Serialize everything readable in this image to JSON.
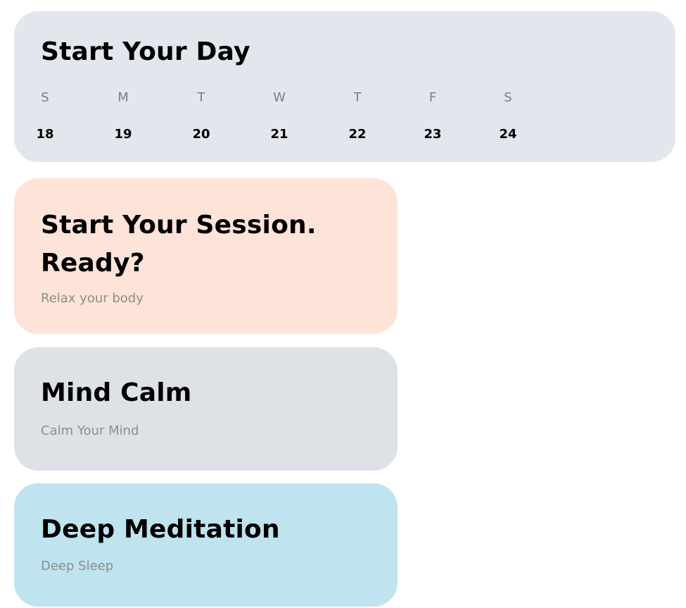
{
  "colors": {
    "day_card_bg": "#e2e6ed",
    "session_card_bg": "#fde3d8",
    "mind_card_bg": "#dee1e6",
    "deep_card_bg": "#bfe3ef"
  },
  "day_card": {
    "title": "Start Your Day",
    "days": [
      {
        "letter": "S",
        "num": "18"
      },
      {
        "letter": "M",
        "num": "19"
      },
      {
        "letter": "T",
        "num": "20"
      },
      {
        "letter": "W",
        "num": "21"
      },
      {
        "letter": "T",
        "num": "22"
      },
      {
        "letter": "F",
        "num": "23"
      },
      {
        "letter": "S",
        "num": "24"
      }
    ]
  },
  "session_card": {
    "title": "Start Your Session. Ready?",
    "subtitle": "Relax your body"
  },
  "mind_card": {
    "title": "Mind Calm",
    "subtitle": "Calm Your Mind"
  },
  "deep_card": {
    "title": "Deep Meditation",
    "subtitle": "Deep Sleep"
  }
}
